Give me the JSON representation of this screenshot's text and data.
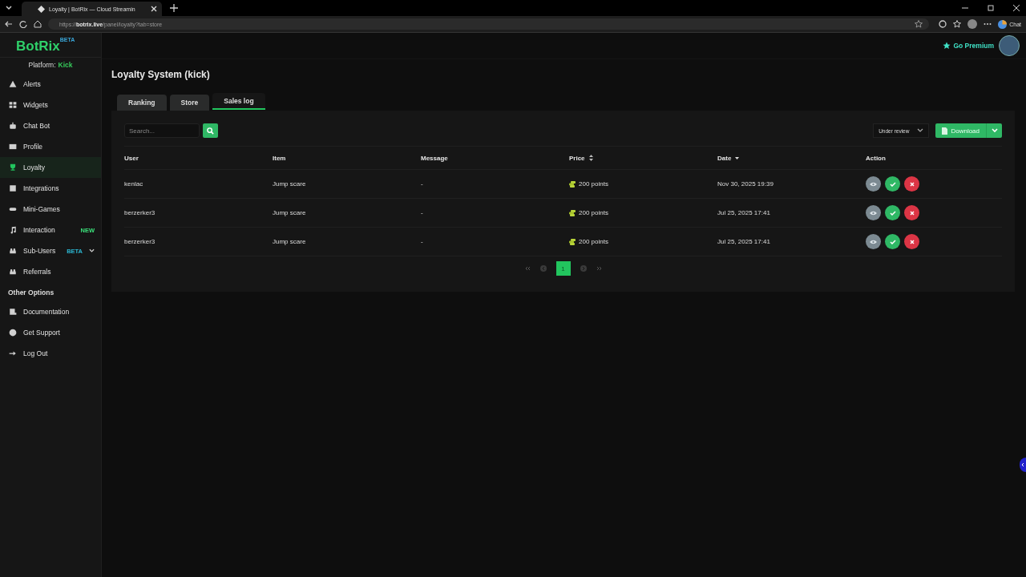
{
  "browser": {
    "tab_title": "Loyalty | BotRix — Cloud Streamin",
    "url_prefix": "https://",
    "url_host": "botrix.live",
    "url_path": "/panel/loyalty?tab=store",
    "chat_label": "Chat"
  },
  "sidebar": {
    "logo": "BotRix",
    "logo_badge": "BETA",
    "platform_label": "Platform:",
    "platform_value": "Kick",
    "items": [
      {
        "label": "Alerts",
        "selected": false,
        "expandable": false
      },
      {
        "label": "Widgets",
        "selected": false,
        "expandable": false
      },
      {
        "label": "Chat Bot",
        "selected": false,
        "expandable": false
      },
      {
        "label": "Profile",
        "selected": false,
        "expandable": false
      },
      {
        "label": "Loyalty",
        "selected": true,
        "expandable": false
      },
      {
        "label": "Integrations",
        "selected": false,
        "expandable": false
      },
      {
        "label": "Mini-Games",
        "selected": false,
        "expandable": false
      },
      {
        "label": "Interaction",
        "selected": false,
        "expandable": false,
        "badge": {
          "text": "NEW",
          "kind": "new"
        }
      },
      {
        "label": "Sub-Users",
        "selected": false,
        "expandable": true,
        "badge": {
          "text": "BETA",
          "kind": "beta"
        }
      },
      {
        "label": "Referrals",
        "selected": false,
        "expandable": false
      }
    ],
    "section_title": "Other Options",
    "other_items": [
      {
        "label": "Documentation"
      },
      {
        "label": "Get Support"
      },
      {
        "label": "Log Out"
      }
    ]
  },
  "header": {
    "premium_label": "Go Premium"
  },
  "page": {
    "title": "Loyalty System (kick)",
    "tabs": [
      {
        "label": "Ranking",
        "selected": false
      },
      {
        "label": "Store",
        "selected": false
      },
      {
        "label": "Sales log",
        "selected": true
      }
    ],
    "search": {
      "placeholder": "Search..."
    },
    "filter": {
      "value": "Under review"
    },
    "download_label": "Download",
    "table": {
      "columns": [
        {
          "label": "User",
          "sortable": false,
          "sorted": false
        },
        {
          "label": "Item",
          "sortable": false,
          "sorted": false
        },
        {
          "label": "Message",
          "sortable": false,
          "sorted": false
        },
        {
          "label": "Price",
          "sortable": true,
          "sorted": false
        },
        {
          "label": "Date",
          "sortable": true,
          "sorted": true
        },
        {
          "label": "Action",
          "sortable": false,
          "sorted": false
        }
      ],
      "rows": [
        {
          "user": "kenlac",
          "item": "Jump scare",
          "message": "-",
          "price": "200 points",
          "date": "Nov 30, 2025 19:39"
        },
        {
          "user": "berzerker3",
          "item": "Jump scare",
          "message": "-",
          "price": "200 points",
          "date": "Jul 25, 2025 17:41"
        },
        {
          "user": "berzerker3",
          "item": "Jump scare",
          "message": "-",
          "price": "200 points",
          "date": "Jul 25, 2025 17:41"
        }
      ]
    },
    "pagination": {
      "pages": [
        {
          "label": "1",
          "selected": true
        }
      ]
    }
  }
}
